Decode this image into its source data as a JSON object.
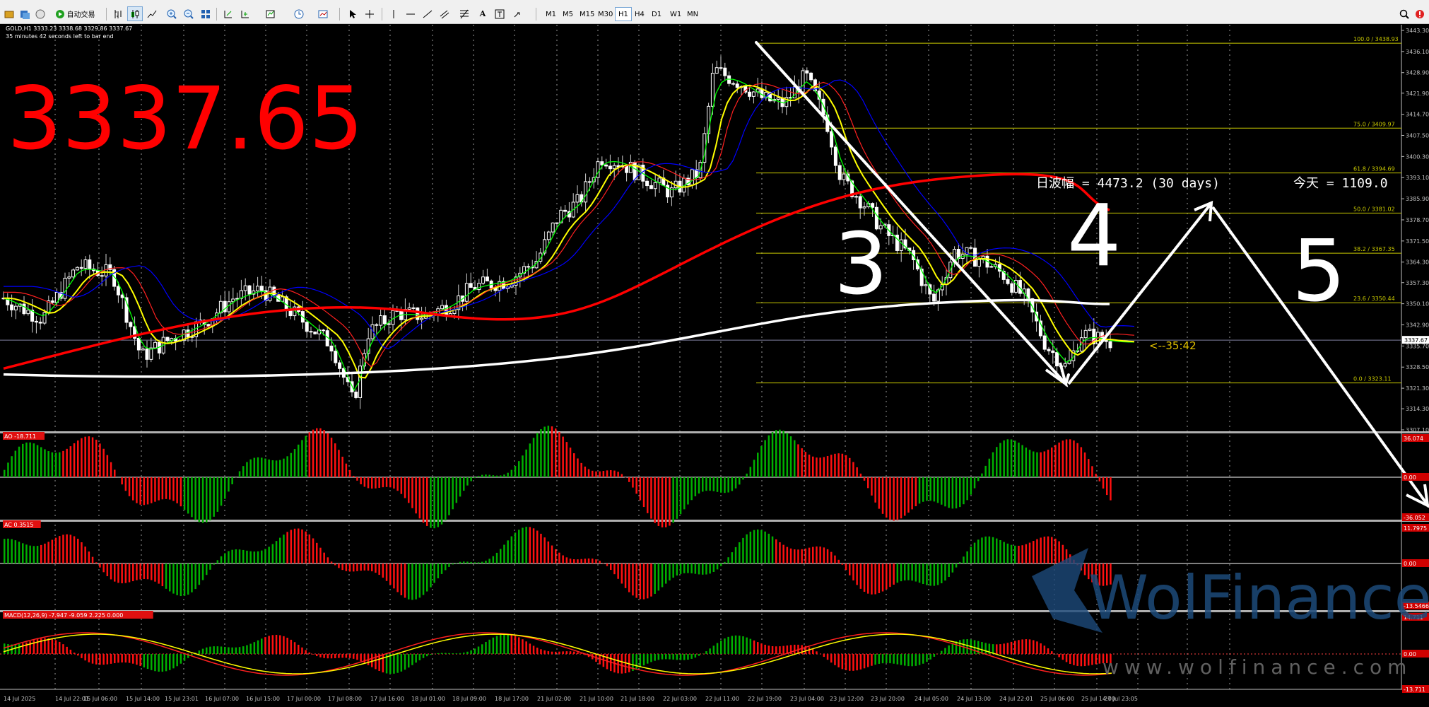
{
  "toolbar": {
    "autotrade_label": "自动交易",
    "timeframes": [
      "M1",
      "M5",
      "M15",
      "M30",
      "H1",
      "H4",
      "D1",
      "W1",
      "MN"
    ],
    "active_timeframe": "H1"
  },
  "chart": {
    "symbol_info": "GOLD,H1  3333.23 3338.68 3329.86 3337.67",
    "bar_timer": "35 minutes 42 seconds left to bar end",
    "big_price": "3337.65",
    "countdown": "<--35:42",
    "range_label": "日波幅 = 4473.2  (30 days)",
    "today_label": "今天 = 1109.0",
    "current_price": "3337.67",
    "wave_labels": [
      "3",
      "4",
      "5"
    ],
    "watermark": "WolFinance",
    "watermark_url": "www.wolfinance.com",
    "price_axis": [
      "3443.30",
      "3436.10",
      "3428.90",
      "3421.90",
      "3414.70",
      "3407.50",
      "3400.30",
      "3393.10",
      "3385.90",
      "3378.70",
      "3371.50",
      "3364.30",
      "3357.30",
      "3350.10",
      "3342.90",
      "3335.70",
      "3328.50",
      "3321.30",
      "3314.30",
      "3307.10"
    ],
    "fib_levels": [
      {
        "label": "100.0 / 3438.93",
        "price": 3438.93
      },
      {
        "label": "75.0 / 3409.97",
        "price": 3409.97
      },
      {
        "label": "61.8 / 3394.69",
        "price": 3394.69
      },
      {
        "label": "50.0 / 3381.02",
        "price": 3381.02
      },
      {
        "label": "38.2 / 3367.35",
        "price": 3367.35
      },
      {
        "label": "23.6 / 3350.44",
        "price": 3350.44
      },
      {
        "label": "0.0 / 3323.11",
        "price": 3323.11
      }
    ],
    "time_labels": [
      "14 Jul 2025",
      "14 Jul 22:01",
      "15 Jul 06:00",
      "15 Jul 14:00",
      "15 Jul 23:01",
      "16 Jul 07:00",
      "16 Jul 15:00",
      "17 Jul 00:00",
      "17 Jul 08:00",
      "17 Jul 16:00",
      "18 Jul 01:00",
      "18 Jul 09:00",
      "18 Jul 17:00",
      "21 Jul 02:00",
      "21 Jul 10:00",
      "21 Jul 18:00",
      "22 Jul 03:00",
      "22 Jul 11:00",
      "22 Jul 19:00",
      "23 Jul 04:00",
      "23 Jul 12:00",
      "23 Jul 20:00",
      "24 Jul 05:00",
      "24 Jul 13:00",
      "24 Jul 22:01",
      "25 Jul 06:00",
      "25 Jul 14:00",
      "27 Jul 23:05"
    ]
  },
  "indicators": {
    "ao": {
      "label": "AO -18.711",
      "max": "36.074",
      "zero": "0.00",
      "min": "-36.052"
    },
    "ac": {
      "label": "AC 0.3515",
      "max": "11.7975",
      "zero": "0.00",
      "min": "-13.5466"
    },
    "macd": {
      "label": "MACD(12,26,9) -7.947 -9.059 2.225 0.000",
      "max": "14.711",
      "zero": "0.00",
      "min": "-13.711"
    }
  },
  "colors": {
    "bull": "#00d000",
    "bear": "#ff0000",
    "ma_red": "#ff0000",
    "ma_blue": "#0000ff",
    "ma_yellow": "#ffff00",
    "ma_green": "#00ff00",
    "fib": "#c8c800",
    "big_price": "#ff0000",
    "bg": "#000000"
  }
}
